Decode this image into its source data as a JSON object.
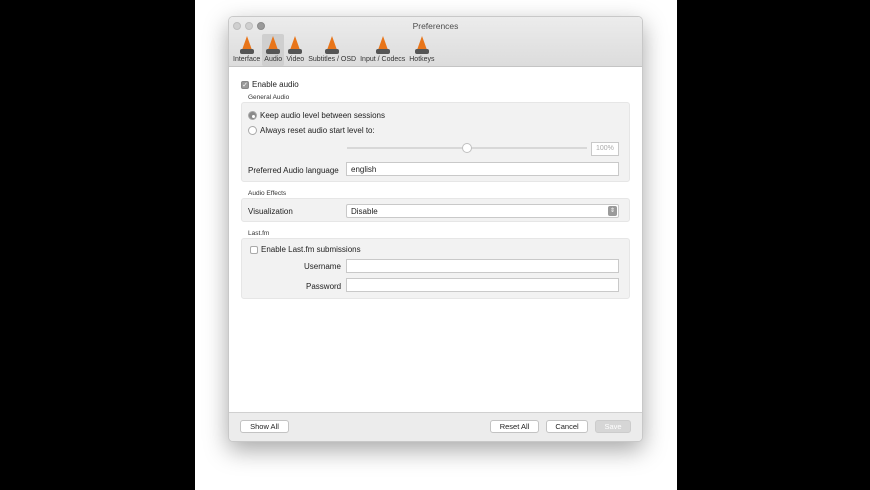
{
  "window": {
    "title": "Preferences"
  },
  "tabs": [
    {
      "label": "Interface"
    },
    {
      "label": "Audio"
    },
    {
      "label": "Video"
    },
    {
      "label": "Subtitles / OSD"
    },
    {
      "label": "Input / Codecs"
    },
    {
      "label": "Hotkeys"
    }
  ],
  "audio": {
    "enable_audio": "Enable audio",
    "enable_audio_checked": true,
    "general_audio": "General Audio",
    "keep_level": "Keep audio level between sessions",
    "always_reset": "Always reset audio start level to:",
    "level_value": "100%",
    "level_fraction": 0.5,
    "pref_lang_label": "Preferred Audio language",
    "pref_lang_value": "english",
    "audio_effects": "Audio Effects",
    "visualization_label": "Visualization",
    "visualization_value": "Disable",
    "lastfm": "Last.fm",
    "enable_lastfm": "Enable Last.fm submissions",
    "username_label": "Username",
    "username_value": "",
    "password_label": "Password",
    "password_value": ""
  },
  "footer": {
    "show_all": "Show All",
    "reset_all": "Reset All",
    "cancel": "Cancel",
    "save": "Save"
  }
}
